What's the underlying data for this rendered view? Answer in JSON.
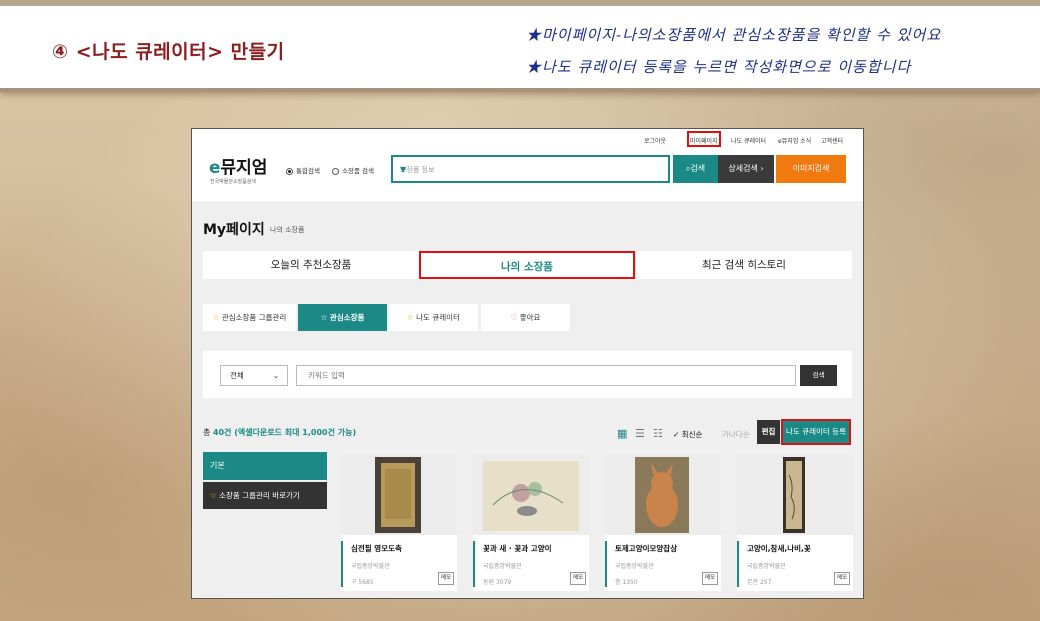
{
  "slide": {
    "title": "④ <나도 큐레이터> 만들기",
    "notes": [
      "★마이페이지-나의소장품에서 관심소장품을 확인할 수 있어요",
      "★나도 큐레이터 등록을 누르면 작성화면으로 이동합니다"
    ]
  },
  "site": {
    "util_links": [
      "로그아웃",
      "마이페이지",
      "나도 큐레이터",
      "e뮤지엄 소식",
      "고객센터"
    ],
    "logo_main": "뮤지엄",
    "logo_prefix": "e",
    "logo_sub": "전국박물관소장품검색",
    "radios": [
      "통합검색",
      "소장품 검색"
    ],
    "search_placeholder": "소장품 정보",
    "search_btn": "검색",
    "detail_btn": "상세검색",
    "image_btn": "이미지검색"
  },
  "mypage": {
    "title": "My페이지",
    "crumb": "나의 소장품",
    "tabs": [
      "오늘의 추천소장품",
      "나의 소장품",
      "최근 검색 히스토리"
    ],
    "subtabs": [
      "관심소장품 그룹관리",
      "관심소장품",
      "나도 큐레이터",
      "좋아요"
    ],
    "filter_select": "전체",
    "keyword_placeholder": "키워드 입력",
    "keyword_btn": "검색",
    "total_prefix": "총 ",
    "total_count": "40건",
    "total_suffix": " (엑셀다운로드 최대 1,000건 가능)",
    "sort_latest": "최신순",
    "sort_abc": "가나다순",
    "edit_btn": "편집",
    "register_btn": "나도 큐레이터 등록",
    "side_basic": "기본",
    "side_group": "소장품 그룹관리 바로가기",
    "cards": [
      {
        "title": "심전필 영모도축",
        "museum": "국립중앙박물관",
        "num": "구 5685",
        "memo": "메모"
      },
      {
        "title": "꽃과 새 · 꽃과 고양이",
        "museum": "국립중앙박물관",
        "num": "동원 3079",
        "memo": "메모"
      },
      {
        "title": "토제고양이모양잡상",
        "museum": "국립중앙박물관",
        "num": "증 1350",
        "memo": "메모"
      },
      {
        "title": "고양이,참새,나비,꽃",
        "museum": "국립중앙박물관",
        "num": "본관 257",
        "memo": "메모"
      }
    ]
  },
  "colors": {
    "teal": "#1b8a86",
    "dark": "#333333",
    "orange": "#f07a10",
    "red": "#dd1111"
  }
}
